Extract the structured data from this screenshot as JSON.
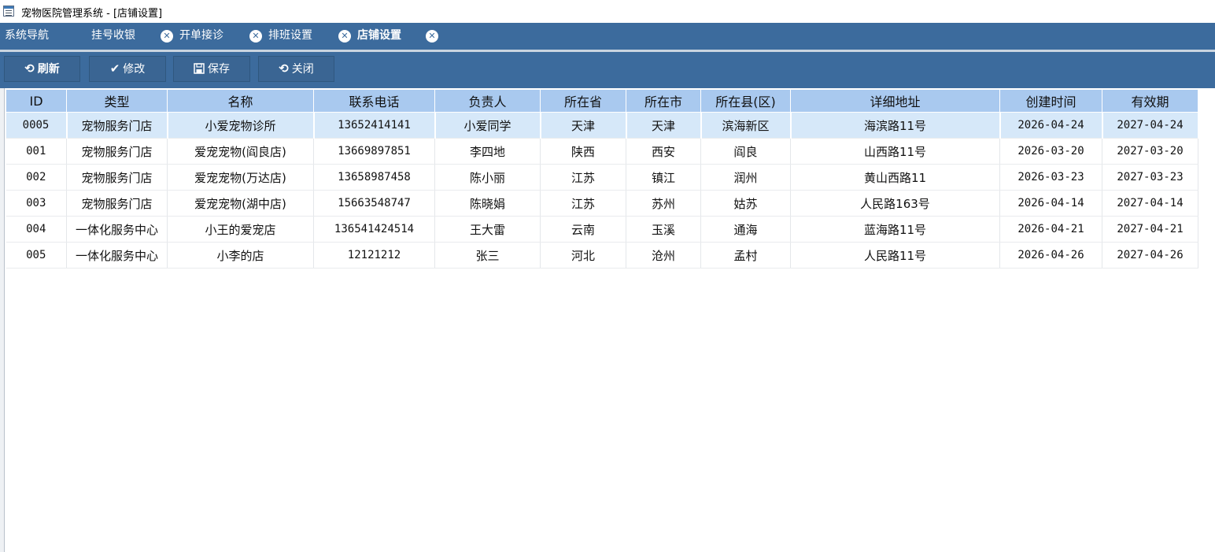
{
  "window": {
    "title": "宠物医院管理系统 - [店铺设置]"
  },
  "nav": {
    "items": [
      {
        "label": "系统导航"
      },
      {
        "label": "挂号收银"
      },
      {
        "label": "开单接诊"
      },
      {
        "label": "排班设置"
      },
      {
        "label": "店铺设置"
      }
    ],
    "close_glyph": "✕"
  },
  "toolbar": {
    "refresh_label": "刷新",
    "edit_label": "修改",
    "save_label": "保存",
    "close_label": "关闭",
    "refresh_icon": "refresh-icon",
    "edit_icon": "check-icon",
    "save_icon": "save-icon",
    "close_icon": "refresh-icon"
  },
  "table": {
    "columns": [
      "ID",
      "类型",
      "名称",
      "联系电话",
      "负责人",
      "所在省",
      "所在市",
      "所在县(区)",
      "详细地址",
      "创建时间",
      "有效期"
    ],
    "rows": [
      [
        "0005",
        "宠物服务门店",
        "小爱宠物诊所",
        "13652414141",
        "小爱同学",
        "天津",
        "天津",
        "滨海新区",
        "海滨路11号",
        "2026-04-24",
        "2027-04-24"
      ],
      [
        "001",
        "宠物服务门店",
        "爱宠宠物(阎良店)",
        "13669897851",
        "李四地",
        "陕西",
        "西安",
        "阎良",
        "山西路11号",
        "2026-03-20",
        "2027-03-20"
      ],
      [
        "002",
        "宠物服务门店",
        "爱宠宠物(万达店)",
        "13658987458",
        "陈小丽",
        "江苏",
        "镇江",
        "润州",
        "黄山西路11",
        "2026-03-23",
        "2027-03-23"
      ],
      [
        "003",
        "宠物服务门店",
        "爱宠宠物(湖中店)",
        "15663548747",
        "陈晓娟",
        "江苏",
        "苏州",
        "姑苏",
        "人民路163号",
        "2026-04-14",
        "2027-04-14"
      ],
      [
        "004",
        "一体化服务中心",
        "小王的爱宠店",
        "136541424514",
        "王大雷",
        "云南",
        "玉溪",
        "通海",
        "蓝海路11号",
        "2026-04-21",
        "2027-04-21"
      ],
      [
        "005",
        "一体化服务中心",
        "小李的店",
        "12121212",
        "张三",
        "河北",
        "沧州",
        "孟村",
        "人民路11号",
        "2026-04-26",
        "2027-04-26"
      ]
    ],
    "selected_row": 0
  },
  "colors": {
    "nav_bg": "#3c6b9d",
    "header_bg": "#a9c9ef",
    "selected_row_bg": "#d6e8f9"
  }
}
